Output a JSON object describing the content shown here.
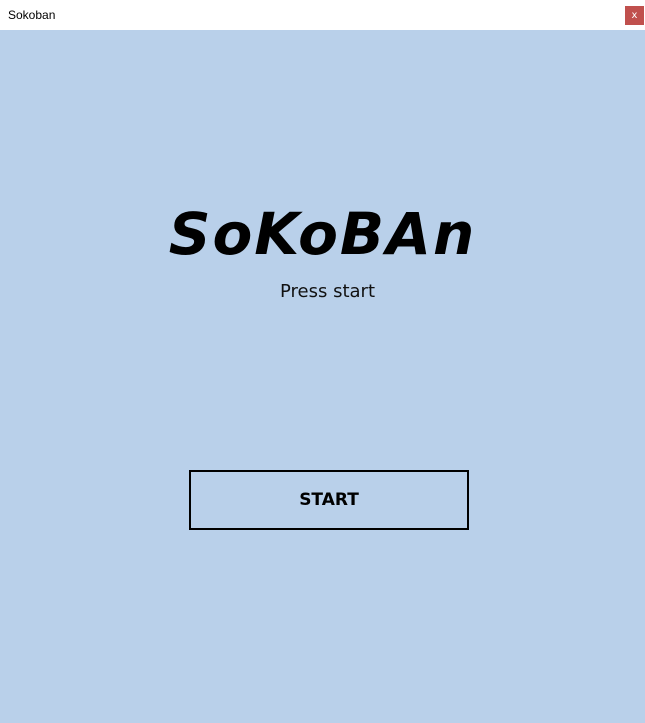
{
  "window": {
    "title": "Sokoban",
    "close_label": "x"
  },
  "main": {
    "logo_text": "SoKoBAn",
    "subtitle": "Press start",
    "start_label": "START"
  },
  "colors": {
    "background": "#b9d0ea",
    "close_button": "#c0504d",
    "text": "#000000"
  }
}
